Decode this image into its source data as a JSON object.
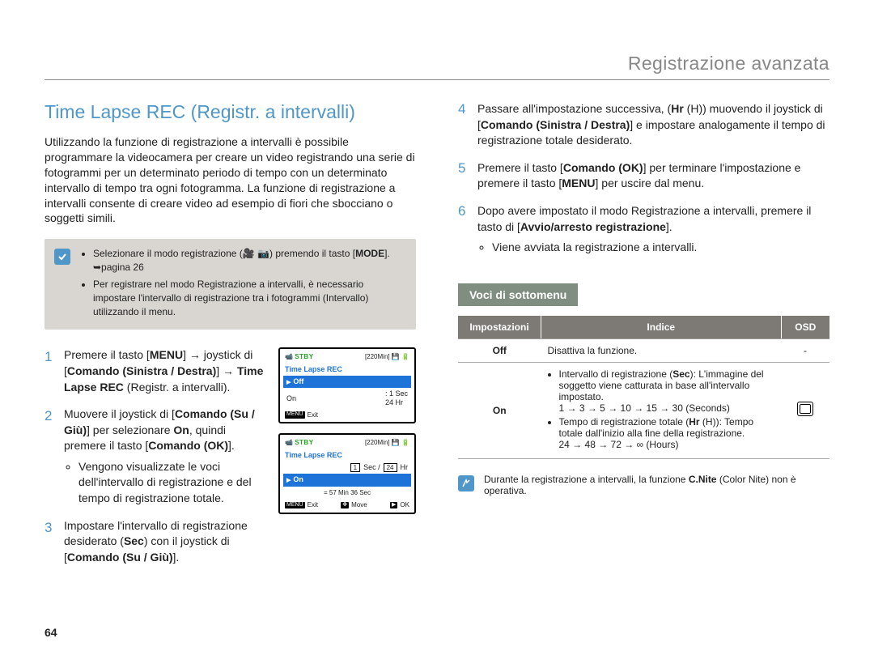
{
  "chapter": "Registrazione avanzata",
  "page_number": "64",
  "title": "Time Lapse REC (Registr. a intervalli)",
  "intro": "Utilizzando la funzione di registrazione a intervalli è possibile programmare la videocamera per creare un video registrando una serie di fotogrammi per un determinato periodo di tempo con un determinato intervallo di tempo tra ogni fotogramma. La funzione di registrazione a intervalli consente di creare video ad esempio di fiori che sbocciano o soggetti simili.",
  "notebox": {
    "item1a": "Selezionare il modo registrazione (",
    "item1b": ") premendo il tasto [",
    "item1c": "]. ",
    "mode": "MODE",
    "page_ref": "➥pagina 26",
    "item2": "Per registrare nel modo Registrazione a intervalli, è necessario impostare l'intervallo di registrazione tra i fotogrammi (Intervallo) utilizzando il menu."
  },
  "steps": {
    "s1": {
      "n": "1",
      "a": "Premere il tasto [",
      "menu": "MENU",
      "b": "] → joystick di [",
      "ctrl": "Comando (Sinistra / Destra)",
      "c": "] → ",
      "tlr": "Time Lapse REC",
      "d": " (Registr. a intervalli)."
    },
    "s2": {
      "n": "2",
      "a": "Muovere il joystick di [",
      "ctrl": "Comando (Su / Giù)",
      "b": "] per selezionare ",
      "on": "On",
      "c": ", quindi premere il tasto [",
      "ok": "Comando (OK)",
      "d": "].",
      "bullet": "Vengono visualizzate le voci dell'intervallo di registrazione e del tempo di registrazione totale."
    },
    "s3": {
      "n": "3",
      "a": "Impostare l'intervallo di registrazione desiderato (",
      "sec": "Sec",
      "b": ") con il joystick di [",
      "ctrl": "Comando (Su / Giù)",
      "c": "]."
    },
    "s4": {
      "n": "4",
      "a": "Passare all'impostazione successiva, (",
      "hr": "Hr",
      "b": " (H)) muovendo il joystick di [",
      "ctrl": "Comando (Sinistra / Destra)",
      "c": "] e impostare analogamente il tempo di registrazione totale desiderato."
    },
    "s5": {
      "n": "5",
      "a": "Premere il tasto [",
      "ok": "Comando (OK)",
      "b": "] per terminare l'impostazione e premere il tasto [",
      "menu": "MENU",
      "c": "] per uscire dal menu."
    },
    "s6": {
      "n": "6",
      "a": "Dopo avere impostato il modo Registrazione a intervalli, premere il tasto di [",
      "rec": "Avvio/arresto registrazione",
      "b": "].",
      "bullet": "Viene avviata la registrazione a intervalli."
    }
  },
  "submenu": {
    "heading": "Voci di sottomenu",
    "th1": "Impostazioni",
    "th2": "Indice",
    "th3": "OSD",
    "row_off": {
      "name": "Off",
      "desc": "Disattiva la funzione.",
      "osd": "-"
    },
    "row_on": {
      "name": "On",
      "b1a": "Intervallo di registrazione (",
      "b1sec": "Sec",
      "b1b": "): L'immagine del soggetto viene catturata in base all'intervallo impostato.",
      "b1seq": "1 → 3 → 5 → 10 → 15 → 30 (Seconds)",
      "b2a": "Tempo di registrazione totale (",
      "b2hr": "Hr",
      "b2b": " (H)): Tempo totale dall'inizio alla fine della registrazione.",
      "b2seq": "24 → 48 → 72 → ∞ (Hours)"
    }
  },
  "tip": {
    "a": "Durante la registrazione a intervalli, la funzione ",
    "cnite": "C.Nite",
    "b": " (Color Nite) non è operativa."
  },
  "lcd1": {
    "stby": "STBY",
    "time": "[220Min]",
    "title": "Time Lapse REC",
    "off": "Off",
    "on": "On",
    "val1": ": 1 Sec",
    "val2": "24 Hr",
    "exit": "Exit",
    "menu_tag": "MENU"
  },
  "lcd2": {
    "stby": "STBY",
    "time": "[220Min]",
    "title": "Time Lapse REC",
    "on": "On",
    "secbox": "1",
    "seclabel": "Sec /",
    "hrbox": "24",
    "hrlabel": "Hr",
    "info": "= 57 Min 36 Sec",
    "exit": "Exit",
    "move": "Move",
    "ok": "OK",
    "menu_tag": "MENU",
    "move_tag": "✥",
    "ok_tag": "▶"
  }
}
